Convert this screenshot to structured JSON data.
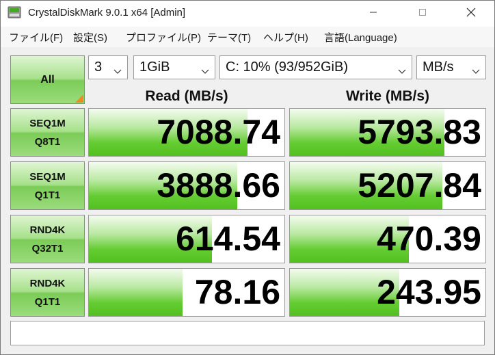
{
  "window": {
    "title": "CrystalDiskMark 9.0.1 x64 [Admin]"
  },
  "menu": {
    "items": [
      {
        "label": "ファイル(F)"
      },
      {
        "label": "設定(S)"
      },
      {
        "label": "プロファイル(P)"
      },
      {
        "label": "テーマ(T)"
      },
      {
        "label": "ヘルプ(H)"
      },
      {
        "label": "言語(Language)"
      }
    ]
  },
  "controls": {
    "all_button": "All",
    "count": "3",
    "size": "1GiB",
    "drive": "C: 10% (93/952GiB)",
    "unit": "MB/s"
  },
  "headers": {
    "read": "Read (MB/s)",
    "write": "Write (MB/s)"
  },
  "tests": [
    {
      "line1": "SEQ1M",
      "line2": "Q8T1",
      "read": "7088.74",
      "write": "5793.83",
      "read_fill": 0.81,
      "write_fill": 0.79
    },
    {
      "line1": "SEQ1M",
      "line2": "Q1T1",
      "read": "3888.66",
      "write": "5207.84",
      "read_fill": 0.76,
      "write_fill": 0.78
    },
    {
      "line1": "RND4K",
      "line2": "Q32T1",
      "read": "614.54",
      "write": "470.39",
      "read_fill": 0.63,
      "write_fill": 0.61
    },
    {
      "line1": "RND4K",
      "line2": "Q1T1",
      "read": "78.16",
      "write": "243.95",
      "read_fill": 0.48,
      "write_fill": 0.56
    }
  ],
  "status": {
    "comment": ""
  },
  "colors": {
    "bar_green": "#52c020",
    "button_green": "#9bdc7c",
    "corner_orange": "#f08a24"
  },
  "icons": {
    "app": "disk-icon",
    "minimize": "minimize-icon",
    "maximize": "maximize-icon",
    "close": "close-icon",
    "dropdown": "chevron-down-icon"
  }
}
